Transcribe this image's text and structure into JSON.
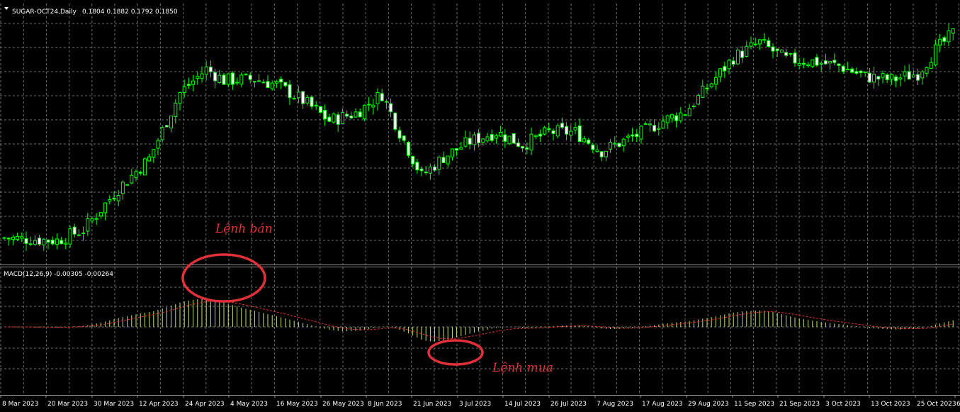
{
  "main_header": {
    "symbol_label": "SUGAR-OCT24,Daily",
    "ohlc_label": "0.1804 0.1882 0.1792 0.1850"
  },
  "macd_header": {
    "label": "MACD(12,26,9) -0.00305 -0.00264"
  },
  "annotations": {
    "sell": "Lệnh bán",
    "buy": "Lệnh mua"
  },
  "colors": {
    "background": "#000000",
    "grid": "#6f6f6f",
    "candle": "#00ff00",
    "candle_up_fill": "#000000",
    "candle_down_fill": "#ffffff",
    "histogram": "#bfe66f",
    "signal": "#e03030",
    "annotation": "#e0313a",
    "separator": "#8a8a8a"
  },
  "chart_data": {
    "type": "candlestick",
    "x_tick_labels": [
      "8 Mar 2023",
      "20 Mar 2023",
      "30 Mar 2023",
      "12 Apr 2023",
      "24 Apr 2023",
      "4 May 2023",
      "16 May 2023",
      "26 May 2023",
      "8 Jun 2023",
      "21 Jun 2023",
      "3 Jul 2023",
      "14 Jul 2023",
      "26 Jul 2023",
      "7 Aug 2023",
      "17 Aug 2023",
      "29 Aug 2023",
      "11 Sep 2023",
      "21 Sep 2023",
      "3 Oct 2023",
      "13 Oct 2023",
      "25 Oct 2023",
      "6"
    ],
    "grid": true,
    "price_series": {
      "name": "SUGAR-OCT24,Daily",
      "close_trajectory": [
        [
          0,
          0.2032
        ],
        [
          12,
          0.2028
        ],
        [
          18,
          0.2045
        ],
        [
          26,
          0.211
        ],
        [
          33,
          0.2158
        ],
        [
          40,
          0.2262
        ],
        [
          46,
          0.23
        ],
        [
          50,
          0.2282
        ],
        [
          57,
          0.2284
        ],
        [
          62,
          0.2275
        ],
        [
          68,
          0.225
        ],
        [
          74,
          0.2218
        ],
        [
          80,
          0.223
        ],
        [
          86,
          0.226
        ],
        [
          90,
          0.22
        ],
        [
          95,
          0.213
        ],
        [
          100,
          0.216
        ],
        [
          106,
          0.2185
        ],
        [
          112,
          0.22
        ],
        [
          118,
          0.218
        ],
        [
          124,
          0.22
        ],
        [
          130,
          0.22
        ],
        [
          136,
          0.217
        ],
        [
          144,
          0.2195
        ],
        [
          150,
          0.2218
        ],
        [
          155,
          0.2232
        ],
        [
          160,
          0.227
        ],
        [
          166,
          0.2318
        ],
        [
          172,
          0.2342
        ],
        [
          178,
          0.2315
        ],
        [
          184,
          0.2312
        ],
        [
          190,
          0.2305
        ],
        [
          196,
          0.2288
        ],
        [
          202,
          0.2283
        ],
        [
          208,
          0.2293
        ],
        [
          212,
          0.233
        ],
        [
          216,
          0.2356
        ]
      ],
      "last": {
        "open": 0.1804,
        "high": 0.1882,
        "low": 0.1792,
        "close": 0.185
      }
    },
    "macd": {
      "name": "MACD(12,26,9)",
      "main_value": -0.00305,
      "signal_value": -0.00264,
      "ylim": [
        -0.006,
        0.01
      ]
    }
  }
}
